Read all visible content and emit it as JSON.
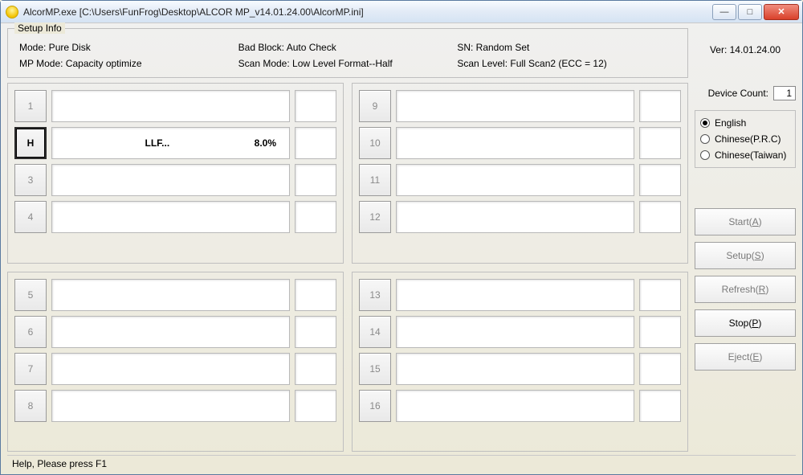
{
  "window": {
    "title": "AlcorMP.exe [C:\\Users\\FunFrog\\Desktop\\ALCOR MP_v14.01.24.00\\AlcorMP.ini]"
  },
  "setup": {
    "legend": "Setup Info",
    "mode": "Mode: Pure Disk",
    "badblock": "Bad Block: Auto Check",
    "sn": "SN: Random Set",
    "mpmode": "MP Mode: Capacity optimize",
    "scanmode": "Scan Mode: Low Level Format--Half",
    "scanlevel": "Scan Level: Full Scan2 (ECC = 12)"
  },
  "version": "Ver: 14.01.24.00",
  "device_count": {
    "label": "Device Count:",
    "value": "1"
  },
  "lang": {
    "english": "English",
    "prc": "Chinese(P.R.C)",
    "taiwan": "Chinese(Taiwan)"
  },
  "buttons": {
    "start": {
      "text": "Start(",
      "hot": "A",
      "tail": ")"
    },
    "setup": {
      "text": "Setup(",
      "hot": "S",
      "tail": ")"
    },
    "refresh": {
      "text": "Refresh(",
      "hot": "R",
      "tail": ")"
    },
    "stop": {
      "text": "Stop(",
      "hot": "P",
      "tail": ")"
    },
    "eject": {
      "text": "Eject(",
      "hot": "E",
      "tail": ")"
    }
  },
  "slots": {
    "s1": {
      "num": "1"
    },
    "s2": {
      "num": "H",
      "status": "LLF...",
      "pct": "8.0%"
    },
    "s3": {
      "num": "3"
    },
    "s4": {
      "num": "4"
    },
    "s5": {
      "num": "5"
    },
    "s6": {
      "num": "6"
    },
    "s7": {
      "num": "7"
    },
    "s8": {
      "num": "8"
    },
    "s9": {
      "num": "9"
    },
    "s10": {
      "num": "10"
    },
    "s11": {
      "num": "11"
    },
    "s12": {
      "num": "12"
    },
    "s13": {
      "num": "13"
    },
    "s14": {
      "num": "14"
    },
    "s15": {
      "num": "15"
    },
    "s16": {
      "num": "16"
    }
  },
  "statusbar": "Help, Please press F1"
}
